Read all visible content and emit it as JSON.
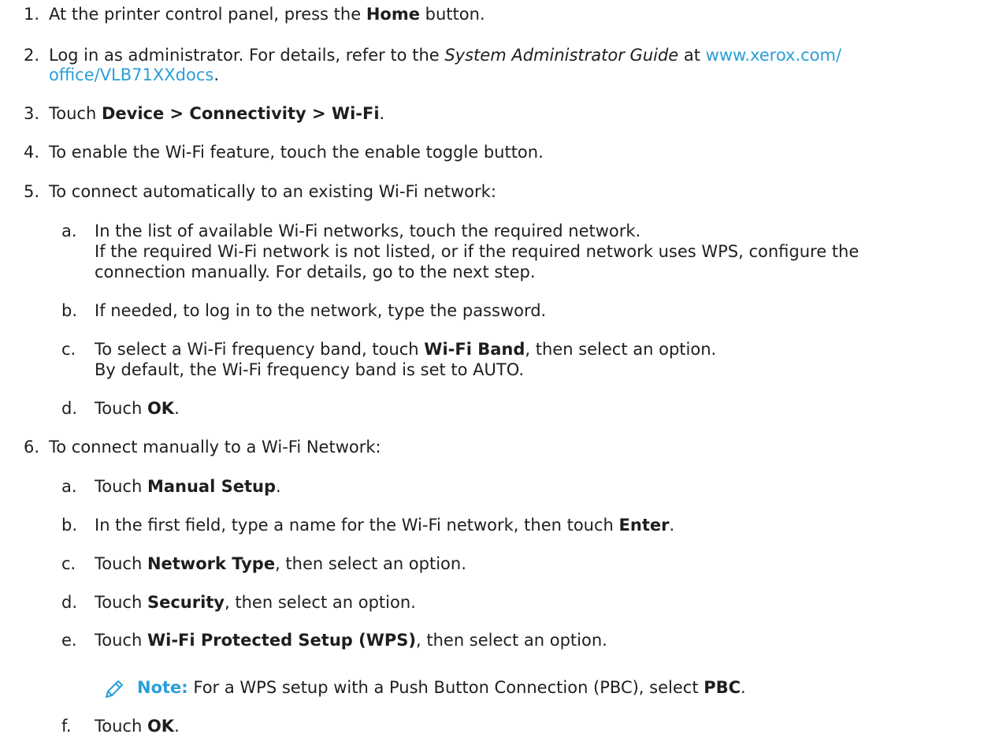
{
  "steps": {
    "s1": {
      "num": "1.",
      "pre": "At the printer control panel, press the ",
      "b1": "Home",
      "post": " button."
    },
    "s2": {
      "num": "2.",
      "pre": "Log in as administrator. For details, refer to the ",
      "guide": "System Administrator Guide",
      "mid": " at ",
      "link1": "www.xerox.com/",
      "link2": "office/VLB71XXdocs",
      "post": "."
    },
    "s3": {
      "num": "3.",
      "pre": "Touch ",
      "b1": "Device > Connectivity > Wi-Fi",
      "post": "."
    },
    "s4": {
      "num": "4.",
      "text": "To enable the Wi-Fi feature, touch the enable toggle button."
    },
    "s5": {
      "num": "5.",
      "text": "To connect automatically to an existing Wi-Fi network:"
    },
    "s6": {
      "num": "6.",
      "text": "To connect manually to a Wi-Fi Network:"
    }
  },
  "auto": {
    "a": {
      "num": "a.",
      "line1": "In the list of available Wi-Fi networks, touch the required network.",
      "line2": "If the required Wi-Fi network is not listed, or if the required network uses WPS, configure the",
      "line3": "connection manually. For details, go to the next step."
    },
    "b": {
      "num": "b.",
      "text": "If needed, to log in to the network, type the password."
    },
    "c": {
      "num": "c.",
      "pre": "To select a Wi-Fi frequency band, touch ",
      "b1": "Wi-Fi Band",
      "post": ", then select an option.",
      "line2": "By default, the Wi-Fi frequency band is set to AUTO."
    },
    "d": {
      "num": "d.",
      "pre": "Touch ",
      "b1": "OK",
      "post": "."
    }
  },
  "manual": {
    "a": {
      "num": "a.",
      "pre": "Touch ",
      "b1": "Manual Setup",
      "post": "."
    },
    "b": {
      "num": "b.",
      "pre": "In the first field, type a name for the Wi-Fi network, then touch ",
      "b1": "Enter",
      "post": "."
    },
    "c": {
      "num": "c.",
      "pre": "Touch ",
      "b1": "Network Type",
      "post": ", then select an option."
    },
    "d": {
      "num": "d.",
      "pre": "Touch ",
      "b1": "Security",
      "post": ", then select an option."
    },
    "e": {
      "num": "e.",
      "pre": "Touch ",
      "b1": "Wi-Fi Protected Setup (WPS)",
      "post": ", then select an option."
    },
    "f": {
      "num": "f.",
      "pre": "Touch ",
      "b1": "OK",
      "post": "."
    }
  },
  "note": {
    "icon": "pencil-icon",
    "label": "Note:",
    "pre": " For a WPS setup with a Push Button Connection (PBC), select ",
    "b1": "PBC",
    "post": "."
  },
  "colors": {
    "link": "#2a9fd8",
    "text": "#1e1e1e"
  }
}
